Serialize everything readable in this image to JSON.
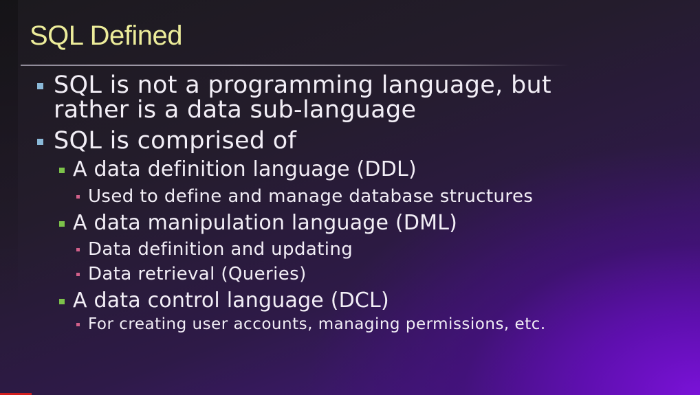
{
  "slide": {
    "title": "SQL Defined",
    "bullets": [
      {
        "level": 1,
        "lines": [
          "SQL is not a programming language, but",
          "rather is a data sub-language"
        ]
      },
      {
        "level": 1,
        "text": "SQL is comprised of"
      },
      {
        "level": 2,
        "text": "A data definition language (DDL)"
      },
      {
        "level": 3,
        "text": "Used to define and manage database structures"
      },
      {
        "level": 2,
        "text": "A data manipulation language (DML)"
      },
      {
        "level": 3,
        "text": "Data definition and updating"
      },
      {
        "level": 3,
        "text": "Data retrieval (Queries)"
      },
      {
        "level": 2,
        "text": "A data control language (DCL)"
      },
      {
        "level": 3,
        "text": "For creating user accounts, managing permissions, etc."
      }
    ]
  },
  "colors": {
    "title": "#ecec9a",
    "body_text": "#f2eef6",
    "level1_bullet": "#8ab9d8",
    "level2_bullet": "#7cc24a",
    "level3_bullet": "#d2608a",
    "background_dark": "#1c1a1e",
    "background_accent": "#7a12d8"
  },
  "icons": {
    "level1": "square-bullet-icon",
    "level2": "square-bullet-icon",
    "level3": "square-bullet-icon"
  }
}
